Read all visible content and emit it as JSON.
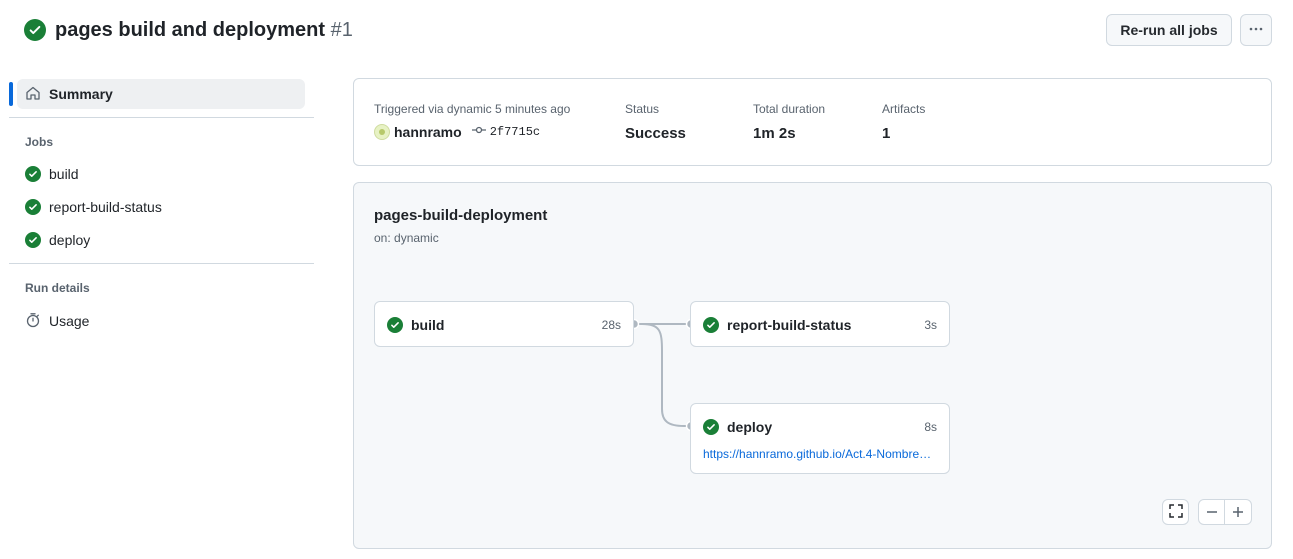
{
  "header": {
    "title": "pages build and deployment",
    "run_number": "#1",
    "rerun_label": "Re-run all jobs",
    "more_icon": "kebab-horizontal-icon"
  },
  "sidebar": {
    "summary_label": "Summary",
    "jobs_heading": "Jobs",
    "jobs": [
      {
        "label": "build"
      },
      {
        "label": "report-build-status"
      },
      {
        "label": "deploy"
      }
    ],
    "run_details_heading": "Run details",
    "usage_label": "Usage"
  },
  "summary": {
    "trigger_label": "Triggered via dynamic 5 minutes ago",
    "actor": "hannramo",
    "commit": "2f7715c",
    "status_label": "Status",
    "status_value": "Success",
    "duration_label": "Total duration",
    "duration_value": "1m 2s",
    "artifacts_label": "Artifacts",
    "artifacts_value": "1"
  },
  "workflow": {
    "name": "pages-build-deployment",
    "trigger": "on: dynamic",
    "jobs": [
      {
        "name": "build",
        "duration": "28s"
      },
      {
        "name": "report-build-status",
        "duration": "3s"
      },
      {
        "name": "deploy",
        "duration": "8s",
        "url": "https://hannramo.github.io/Act.4-Nombre…"
      }
    ]
  },
  "colors": {
    "success": "#1a7f37",
    "accent": "#0969da",
    "border": "#d1d9e0",
    "canvas_subtle": "#f6f8fa"
  }
}
